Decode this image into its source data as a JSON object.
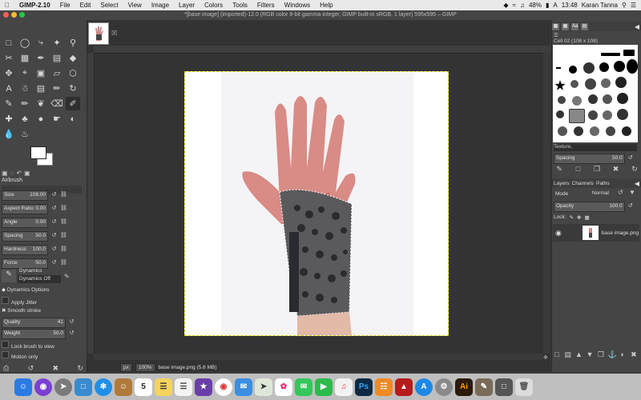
{
  "menubar": {
    "app_name": "GIMP-2.10",
    "items": [
      "File",
      "Edit",
      "Select",
      "View",
      "Image",
      "Layer",
      "Colors",
      "Tools",
      "Filters",
      "Windows",
      "Help"
    ],
    "battery": "48%",
    "clock": "13:48",
    "user": "Karan Tanna"
  },
  "window": {
    "title": "*[base image] (imported)-12.0 (RGB color 8-bit gamma integer, GIMP built-in sRGB, 1 layer) 595x595 – GIMP"
  },
  "tool_options": {
    "title": "Airbrush",
    "fields": [
      {
        "label": "Size",
        "value": "108.00"
      },
      {
        "label": "Aspect Ratio",
        "value": "0.00"
      },
      {
        "label": "Angle",
        "value": "0.00"
      },
      {
        "label": "Spacing",
        "value": "50.0"
      },
      {
        "label": "Hardness",
        "value": "100.0"
      },
      {
        "label": "Force",
        "value": "50.0"
      }
    ],
    "dynamics_label": "Dynamics",
    "dynamics_value": "Dynamics Off",
    "dynamics_options": "Dynamics Options",
    "apply_jitter": "Apply Jitter",
    "smooth_stroke": "Smooth stroke",
    "quality_label": "Quality",
    "quality_value": "41",
    "weight_label": "Weight",
    "weight_value": "50.0",
    "lock_brush": "Lock brush to view",
    "motion_only": "Motion only"
  },
  "statusbar": {
    "unit": "px",
    "zoom": "100%",
    "info": "base image.png (5.6 MB)"
  },
  "brushes": {
    "filter_label": "Cell 02 (108 x 108)",
    "tag": "Texture,",
    "spacing_label": "Spacing",
    "spacing_value": "50.0"
  },
  "layers": {
    "tabs": [
      "Layers",
      "Channels",
      "Paths"
    ],
    "mode_label": "Mode",
    "mode_value": "Normal",
    "opacity_label": "Opacity",
    "opacity_value": "100.0",
    "lock_label": "Lock:",
    "layer_name": "base image.png"
  },
  "dock_apps": [
    "finder",
    "siri",
    "launchpad",
    "preview",
    "safari",
    "contacts",
    "calendar",
    "notes",
    "reminders",
    "imovie",
    "chrome",
    "mail",
    "maps",
    "photos",
    "messages",
    "facetime",
    "itunes",
    "photoshop",
    "books",
    "acrobat",
    "appstore",
    "settings",
    "illustrator",
    "gimp",
    "other",
    "trash"
  ],
  "calendar_day": "5",
  "app_letters": {
    "photoshop": "Ps",
    "illustrator": "Ai"
  }
}
